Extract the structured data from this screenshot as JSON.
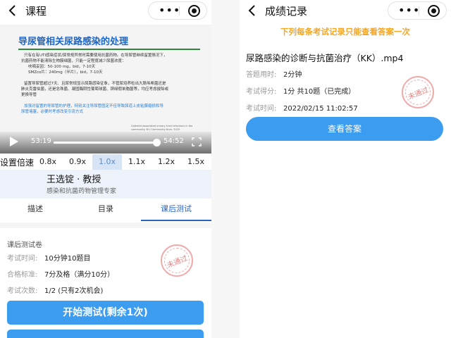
{
  "left": {
    "nav": {
      "title": "课程",
      "more": "•••"
    },
    "video": {
      "slide_title": "导尿管相关尿路感染的处理",
      "slide_lines": [
        {
          "text": "只有在有UTI感染症状/尿常规异常时需要使用抗菌药物。在导尿管继续留置情况下，",
          "style": "b"
        },
        {
          "text": "抗菌药物不能清除生物膜细菌，只能一定程度减少尿菌浓度：",
          "style": ""
        },
        {
          "text": "呋喃妥因：50-100 mg，bid，7-10天",
          "style": "ind"
        },
        {
          "text": "SMZco片：240mg（半片），bid，7-10天",
          "style": "ind"
        },
        {
          "text": "",
          "style": ""
        },
        {
          "text": "留置导尿管超过7天、且尿常规显示尿路感染征象，不管尿培养检出大肠埃希菌还是",
          "style": "b"
        },
        {
          "text": "肺炎克雷伯菌，还是念珠菌、凝固酶阴性葡萄球菌、铜绿假单胞菌等，均应考虑拔除或",
          "style": ""
        },
        {
          "text": "更换导管",
          "style": ""
        },
        {
          "text": "",
          "style": ""
        },
        {
          "text": "加强对留置的导尿管的护理，特别关注导尿管固定不佳导致尿道上皮粘膜磨损和导",
          "style": "b hl"
        },
        {
          "text": "尿管堵塞，必要时考虑改变引流方式",
          "style": "hl"
        }
      ],
      "citation": "Catheter-associated urinary tract infections in the community. Br J Community Nurs. 2019",
      "current_time": "53:19",
      "total_time": "54:52",
      "progress": 0.97
    },
    "speed_label": "设置倍速",
    "speeds": [
      "0.8x",
      "0.9x",
      "1.0x",
      "1.1x",
      "1.2x",
      "1.5x"
    ],
    "active_speed": "1.0x",
    "teacher": {
      "name": "王选锭 · 教授",
      "desc": "感染和抗菌药物管理专家"
    },
    "tabs": [
      "描述",
      "目录",
      "课后测试"
    ],
    "active_tab": "课后测试",
    "quiz": {
      "header": "课后测试卷",
      "rows": [
        {
          "k": "考试时间:",
          "v": "10分钟10题目"
        },
        {
          "k": "合格标准:",
          "v": "7分及格（满分10分）"
        },
        {
          "k": "考试次数:",
          "v": "1/2 (只有2次机会)"
        }
      ],
      "stamp": "未通过",
      "start_button": "开始测试(剩余1次)"
    }
  },
  "right": {
    "nav": {
      "title": "成绩记录",
      "more": "•••"
    },
    "notice": "下列每条考试记录只能查看答案一次",
    "record": {
      "title": "尿路感染的诊断与抗菌治疗（KK）.mp4",
      "rows": [
        {
          "k": "答题用时:",
          "v": "2分钟"
        },
        {
          "k": "考试得分:",
          "v": "1分 共10题（已完成）"
        },
        {
          "k": "考试时间:",
          "v": "2022/02/15 11:02:57"
        }
      ],
      "stamp": "未通过",
      "view_button": "查看答案"
    }
  },
  "colors": {
    "accent": "#3b9cf0",
    "tab_active": "#2864c8",
    "notice": "#f5a623",
    "stamp": "#e26666"
  },
  "icons": [
    "back-arrow-icon",
    "more-dots-icon",
    "close-circle-icon",
    "play-icon",
    "fullscreen-icon",
    "fail-stamp-icon"
  ]
}
